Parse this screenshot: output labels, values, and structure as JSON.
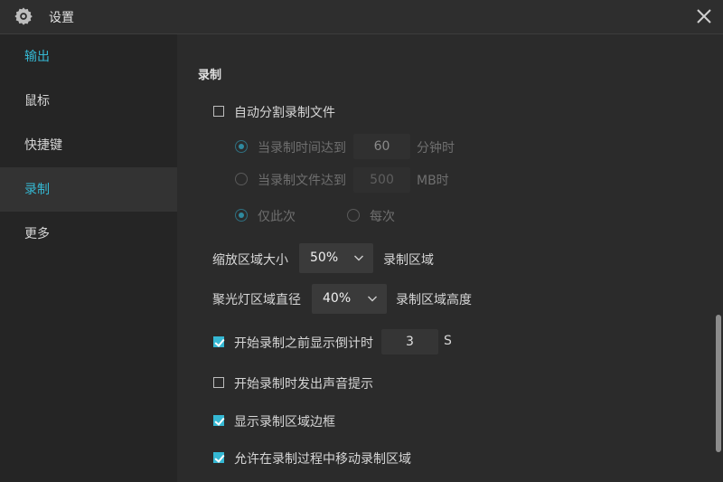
{
  "window": {
    "title": "设置"
  },
  "sidebar": {
    "items": [
      {
        "label": "输出"
      },
      {
        "label": "鼠标"
      },
      {
        "label": "快捷键"
      },
      {
        "label": "录制"
      },
      {
        "label": "更多"
      }
    ],
    "selected": "录制"
  },
  "recording": {
    "section_title": "录制",
    "auto_split": {
      "label": "自动分割录制文件",
      "checked": false
    },
    "split_by_time": {
      "label": "当录制时间达到",
      "value": "60",
      "unit": "分钟时",
      "selected": true
    },
    "split_by_size": {
      "label": "当录制文件达到",
      "value": "500",
      "unit": "MB时",
      "selected": false
    },
    "only_this_time": {
      "label": "仅此次",
      "selected": true
    },
    "every_time": {
      "label": "每次",
      "selected": false
    },
    "zoom": {
      "label": "缩放区域大小",
      "value": "50%",
      "suffix": "录制区域"
    },
    "spotlight": {
      "label": "聚光灯区域直径",
      "value": "40%",
      "suffix": "录制区域高度"
    },
    "countdown": {
      "label": "开始录制之前显示倒计时",
      "checked": true,
      "value": "3",
      "unit": "S"
    },
    "sound_prompt": {
      "label": "开始录制时发出声音提示",
      "checked": false
    },
    "show_border": {
      "label": "显示录制区域边框",
      "checked": true
    },
    "allow_move": {
      "label": "允许在录制过程中移动录制区域",
      "checked": true
    }
  },
  "colors": {
    "accent": "#35b8d3",
    "background": "#2b2b2b",
    "sidebar": "#252525"
  }
}
